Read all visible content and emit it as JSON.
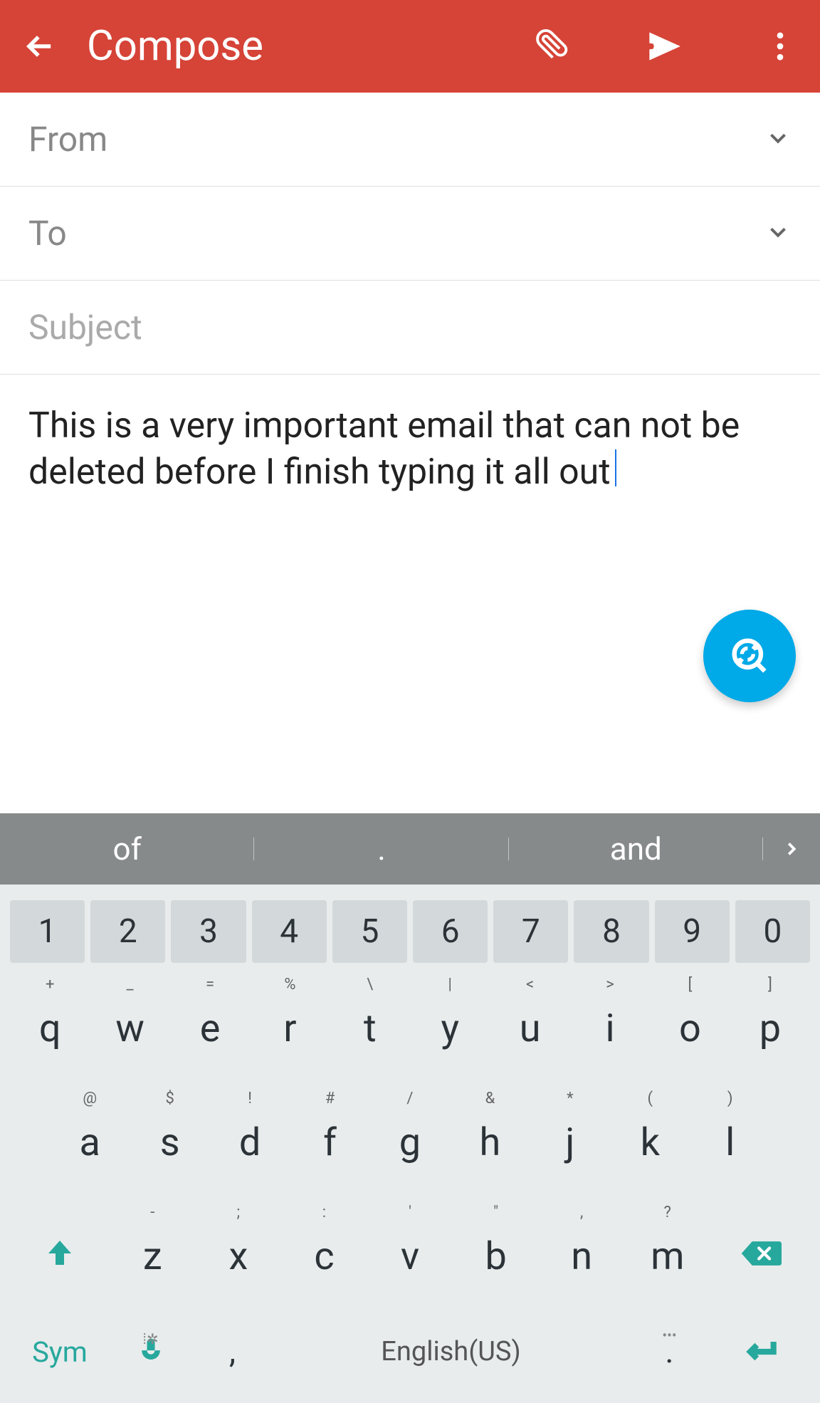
{
  "header": {
    "title": "Compose"
  },
  "fields": {
    "from_label": "From",
    "to_label": "To",
    "subject_placeholder": "Subject"
  },
  "body": {
    "text": "This is a very important email that can not be deleted before I finish typing it all out"
  },
  "keyboard": {
    "suggestions": [
      "of",
      ".",
      "and"
    ],
    "numbers": [
      "1",
      "2",
      "3",
      "4",
      "5",
      "6",
      "7",
      "8",
      "9",
      "0"
    ],
    "row1": [
      {
        "k": "q",
        "h": "+"
      },
      {
        "k": "w",
        "h": "_"
      },
      {
        "k": "e",
        "h": "="
      },
      {
        "k": "r",
        "h": "%"
      },
      {
        "k": "t",
        "h": "\\"
      },
      {
        "k": "y",
        "h": "|"
      },
      {
        "k": "u",
        "h": "<"
      },
      {
        "k": "i",
        "h": ">"
      },
      {
        "k": "o",
        "h": "["
      },
      {
        "k": "p",
        "h": "]"
      }
    ],
    "row2": [
      {
        "k": "a",
        "h": "@"
      },
      {
        "k": "s",
        "h": "$"
      },
      {
        "k": "d",
        "h": "!"
      },
      {
        "k": "f",
        "h": "#"
      },
      {
        "k": "g",
        "h": "/"
      },
      {
        "k": "h",
        "h": "&"
      },
      {
        "k": "j",
        "h": "*"
      },
      {
        "k": "k",
        "h": "("
      },
      {
        "k": "l",
        "h": ")"
      }
    ],
    "row3": [
      {
        "k": "z",
        "h": "-"
      },
      {
        "k": "x",
        "h": ";"
      },
      {
        "k": "c",
        "h": ":"
      },
      {
        "k": "v",
        "h": "'"
      },
      {
        "k": "b",
        "h": "\""
      },
      {
        "k": "n",
        "h": ","
      },
      {
        "k": "m",
        "h": "?"
      }
    ],
    "sym": "Sym",
    "space": "English(US)",
    "comma": ",",
    "period": "."
  }
}
